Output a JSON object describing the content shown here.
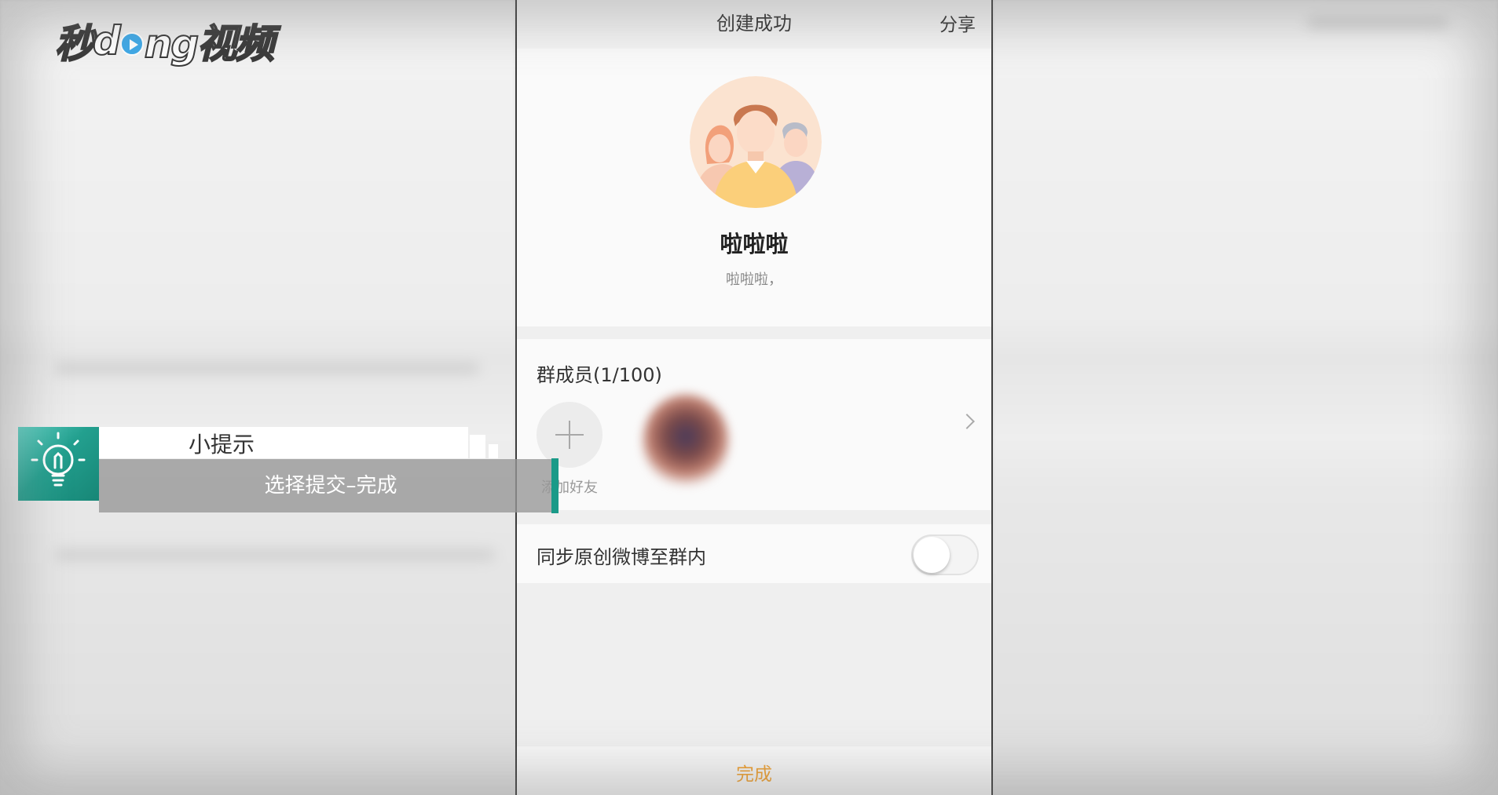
{
  "logo": {
    "text_part1": "秒",
    "text_part2": "d",
    "text_part3": "ng视频"
  },
  "header": {
    "title": "创建成功",
    "share_label": "分享"
  },
  "group": {
    "name": "啦啦啦",
    "description": "啦啦啦，"
  },
  "members": {
    "label": "群成员(1/100)",
    "add_label": "添加好友"
  },
  "sync": {
    "label": "同步原创微博至群内",
    "enabled": false
  },
  "footer": {
    "done_label": "完成"
  },
  "tip": {
    "title": "小提示",
    "text": "选择提交–完成"
  },
  "colors": {
    "accent_orange": "#f0a030",
    "tip_teal": "#1a9a88"
  }
}
